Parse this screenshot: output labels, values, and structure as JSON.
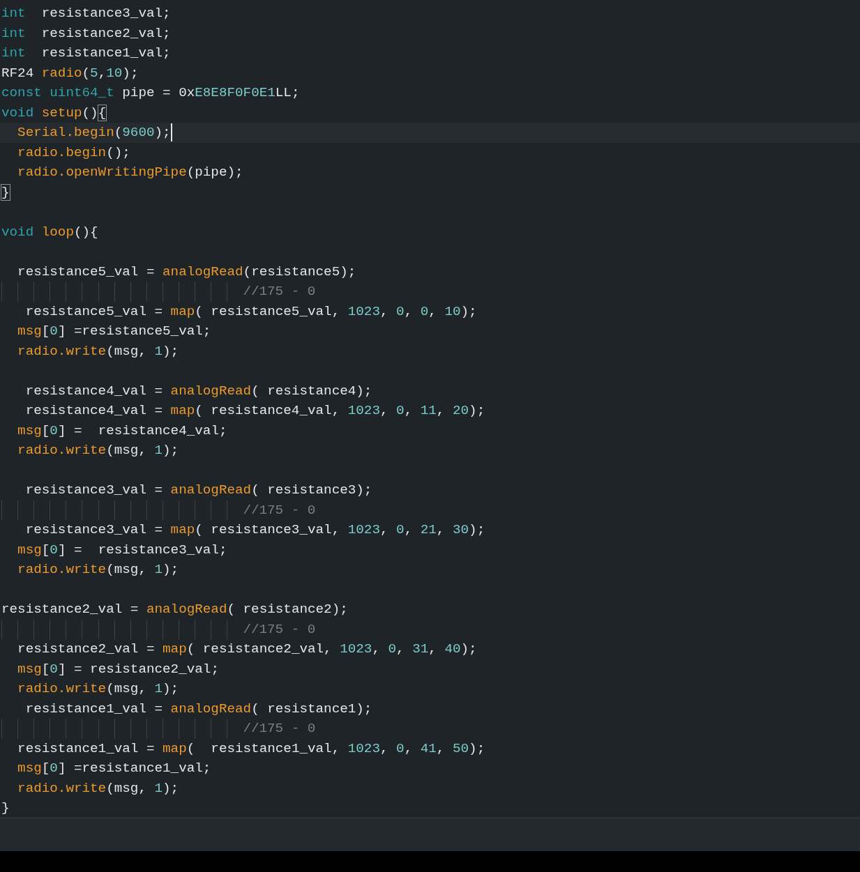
{
  "editor": {
    "lines": [
      {
        "kind": "code",
        "current": false,
        "tokens": [
          {
            "kind": "type",
            "text": "int"
          },
          {
            "kind": "plain",
            "text": "  resistance3_val;"
          }
        ]
      },
      {
        "kind": "code",
        "current": false,
        "tokens": [
          {
            "kind": "type",
            "text": "int"
          },
          {
            "kind": "plain",
            "text": "  resistance2_val;"
          }
        ]
      },
      {
        "kind": "code",
        "current": false,
        "tokens": [
          {
            "kind": "type",
            "text": "int"
          },
          {
            "kind": "plain",
            "text": "  resistance1_val;"
          }
        ]
      },
      {
        "kind": "code",
        "current": false,
        "tokens": [
          {
            "kind": "plain",
            "text": "RF24 "
          },
          {
            "kind": "func",
            "text": "radio"
          },
          {
            "kind": "plain",
            "text": "("
          },
          {
            "kind": "number",
            "text": "5"
          },
          {
            "kind": "plain",
            "text": ","
          },
          {
            "kind": "number",
            "text": "10"
          },
          {
            "kind": "plain",
            "text": ");"
          }
        ]
      },
      {
        "kind": "code",
        "current": false,
        "tokens": [
          {
            "kind": "type",
            "text": "const uint64_t"
          },
          {
            "kind": "plain",
            "text": " pipe = 0x"
          },
          {
            "kind": "number",
            "text": "E8E8F0F0E1"
          },
          {
            "kind": "plain",
            "text": "LL;"
          }
        ]
      },
      {
        "kind": "code",
        "current": false,
        "tokens": [
          {
            "kind": "type",
            "text": "void"
          },
          {
            "kind": "func",
            "text": " setup"
          },
          {
            "kind": "plain",
            "text": "()"
          },
          {
            "kind": "bracket",
            "text": "{"
          }
        ]
      },
      {
        "kind": "code",
        "current": true,
        "tokens": [
          {
            "kind": "func",
            "text": "  Serial.begin"
          },
          {
            "kind": "plain",
            "text": "("
          },
          {
            "kind": "number",
            "text": "9600"
          },
          {
            "kind": "plain",
            "text": ");"
          }
        ]
      },
      {
        "kind": "code",
        "current": false,
        "tokens": [
          {
            "kind": "func",
            "text": "  radio.begin"
          },
          {
            "kind": "plain",
            "text": "();"
          }
        ]
      },
      {
        "kind": "code",
        "current": false,
        "tokens": [
          {
            "kind": "func",
            "text": "  radio.openWritingPipe"
          },
          {
            "kind": "plain",
            "text": "(pipe);"
          }
        ]
      },
      {
        "kind": "code",
        "current": false,
        "tokens": [
          {
            "kind": "bracket",
            "text": "}"
          }
        ]
      },
      {
        "kind": "blank"
      },
      {
        "kind": "code",
        "current": false,
        "tokens": [
          {
            "kind": "type",
            "text": "void"
          },
          {
            "kind": "func",
            "text": " loop"
          },
          {
            "kind": "plain",
            "text": "(){"
          }
        ]
      },
      {
        "kind": "blank"
      },
      {
        "kind": "code",
        "current": false,
        "tokens": [
          {
            "kind": "plain",
            "text": "  resistance5_val = "
          },
          {
            "kind": "func",
            "text": "analogRead"
          },
          {
            "kind": "plain",
            "text": "(resistance5);"
          }
        ]
      },
      {
        "kind": "code",
        "current": false,
        "tokens": [
          {
            "kind": "guided-comment",
            "text": "//175 - 0"
          }
        ]
      },
      {
        "kind": "code",
        "current": false,
        "tokens": [
          {
            "kind": "plain",
            "text": "   resistance5_val = "
          },
          {
            "kind": "func",
            "text": "map"
          },
          {
            "kind": "plain",
            "text": "( resistance5_val, "
          },
          {
            "kind": "number",
            "text": "1023"
          },
          {
            "kind": "plain",
            "text": ", "
          },
          {
            "kind": "number",
            "text": "0"
          },
          {
            "kind": "plain",
            "text": ", "
          },
          {
            "kind": "number",
            "text": "0"
          },
          {
            "kind": "plain",
            "text": ", "
          },
          {
            "kind": "number",
            "text": "10"
          },
          {
            "kind": "plain",
            "text": ");"
          }
        ]
      },
      {
        "kind": "code",
        "current": false,
        "tokens": [
          {
            "kind": "func",
            "text": "  msg"
          },
          {
            "kind": "plain",
            "text": "["
          },
          {
            "kind": "number",
            "text": "0"
          },
          {
            "kind": "plain",
            "text": "] =resistance5_val;"
          }
        ]
      },
      {
        "kind": "code",
        "current": false,
        "tokens": [
          {
            "kind": "func",
            "text": "  radio.write"
          },
          {
            "kind": "plain",
            "text": "(msg, "
          },
          {
            "kind": "number",
            "text": "1"
          },
          {
            "kind": "plain",
            "text": ");"
          }
        ]
      },
      {
        "kind": "blank"
      },
      {
        "kind": "code",
        "current": false,
        "tokens": [
          {
            "kind": "plain",
            "text": "   resistance4_val = "
          },
          {
            "kind": "func",
            "text": "analogRead"
          },
          {
            "kind": "plain",
            "text": "( resistance4);"
          }
        ]
      },
      {
        "kind": "code",
        "current": false,
        "tokens": [
          {
            "kind": "plain",
            "text": "   resistance4_val = "
          },
          {
            "kind": "func",
            "text": "map"
          },
          {
            "kind": "plain",
            "text": "( resistance4_val, "
          },
          {
            "kind": "number",
            "text": "1023"
          },
          {
            "kind": "plain",
            "text": ", "
          },
          {
            "kind": "number",
            "text": "0"
          },
          {
            "kind": "plain",
            "text": ", "
          },
          {
            "kind": "number",
            "text": "11"
          },
          {
            "kind": "plain",
            "text": ", "
          },
          {
            "kind": "number",
            "text": "20"
          },
          {
            "kind": "plain",
            "text": ");"
          }
        ]
      },
      {
        "kind": "code",
        "current": false,
        "tokens": [
          {
            "kind": "func",
            "text": "  msg"
          },
          {
            "kind": "plain",
            "text": "["
          },
          {
            "kind": "number",
            "text": "0"
          },
          {
            "kind": "plain",
            "text": "] =  resistance4_val;"
          }
        ]
      },
      {
        "kind": "code",
        "current": false,
        "tokens": [
          {
            "kind": "func",
            "text": "  radio.write"
          },
          {
            "kind": "plain",
            "text": "(msg, "
          },
          {
            "kind": "number",
            "text": "1"
          },
          {
            "kind": "plain",
            "text": ");"
          }
        ]
      },
      {
        "kind": "blank"
      },
      {
        "kind": "code",
        "current": false,
        "tokens": [
          {
            "kind": "plain",
            "text": "   resistance3_val = "
          },
          {
            "kind": "func",
            "text": "analogRead"
          },
          {
            "kind": "plain",
            "text": "( resistance3);"
          }
        ]
      },
      {
        "kind": "code",
        "current": false,
        "tokens": [
          {
            "kind": "guided-comment",
            "text": "//175 - 0"
          }
        ]
      },
      {
        "kind": "code",
        "current": false,
        "tokens": [
          {
            "kind": "plain",
            "text": "   resistance3_val = "
          },
          {
            "kind": "func",
            "text": "map"
          },
          {
            "kind": "plain",
            "text": "( resistance3_val, "
          },
          {
            "kind": "number",
            "text": "1023"
          },
          {
            "kind": "plain",
            "text": ", "
          },
          {
            "kind": "number",
            "text": "0"
          },
          {
            "kind": "plain",
            "text": ", "
          },
          {
            "kind": "number",
            "text": "21"
          },
          {
            "kind": "plain",
            "text": ", "
          },
          {
            "kind": "number",
            "text": "30"
          },
          {
            "kind": "plain",
            "text": ");"
          }
        ]
      },
      {
        "kind": "code",
        "current": false,
        "tokens": [
          {
            "kind": "func",
            "text": "  msg"
          },
          {
            "kind": "plain",
            "text": "["
          },
          {
            "kind": "number",
            "text": "0"
          },
          {
            "kind": "plain",
            "text": "] =  resistance3_val;"
          }
        ]
      },
      {
        "kind": "code",
        "current": false,
        "tokens": [
          {
            "kind": "func",
            "text": "  radio.write"
          },
          {
            "kind": "plain",
            "text": "(msg, "
          },
          {
            "kind": "number",
            "text": "1"
          },
          {
            "kind": "plain",
            "text": ");"
          }
        ]
      },
      {
        "kind": "blank"
      },
      {
        "kind": "code",
        "current": false,
        "tokens": [
          {
            "kind": "plain",
            "text": "resistance2_val = "
          },
          {
            "kind": "func",
            "text": "analogRead"
          },
          {
            "kind": "plain",
            "text": "( resistance2);"
          }
        ]
      },
      {
        "kind": "code",
        "current": false,
        "tokens": [
          {
            "kind": "guided-comment",
            "text": "//175 - 0"
          }
        ]
      },
      {
        "kind": "code",
        "current": false,
        "tokens": [
          {
            "kind": "plain",
            "text": "  resistance2_val = "
          },
          {
            "kind": "func",
            "text": "map"
          },
          {
            "kind": "plain",
            "text": "( resistance2_val, "
          },
          {
            "kind": "number",
            "text": "1023"
          },
          {
            "kind": "plain",
            "text": ", "
          },
          {
            "kind": "number",
            "text": "0"
          },
          {
            "kind": "plain",
            "text": ", "
          },
          {
            "kind": "number",
            "text": "31"
          },
          {
            "kind": "plain",
            "text": ", "
          },
          {
            "kind": "number",
            "text": "40"
          },
          {
            "kind": "plain",
            "text": ");"
          }
        ]
      },
      {
        "kind": "code",
        "current": false,
        "tokens": [
          {
            "kind": "func",
            "text": "  msg"
          },
          {
            "kind": "plain",
            "text": "["
          },
          {
            "kind": "number",
            "text": "0"
          },
          {
            "kind": "plain",
            "text": "] = resistance2_val;"
          }
        ]
      },
      {
        "kind": "code",
        "current": false,
        "tokens": [
          {
            "kind": "func",
            "text": "  radio.write"
          },
          {
            "kind": "plain",
            "text": "(msg, "
          },
          {
            "kind": "number",
            "text": "1"
          },
          {
            "kind": "plain",
            "text": ");"
          }
        ]
      },
      {
        "kind": "code",
        "current": false,
        "tokens": [
          {
            "kind": "plain",
            "text": "   resistance1_val = "
          },
          {
            "kind": "func",
            "text": "analogRead"
          },
          {
            "kind": "plain",
            "text": "( resistance1);"
          }
        ]
      },
      {
        "kind": "code",
        "current": false,
        "tokens": [
          {
            "kind": "guided-comment",
            "text": "//175 - 0"
          }
        ]
      },
      {
        "kind": "code",
        "current": false,
        "tokens": [
          {
            "kind": "plain",
            "text": "  resistance1_val = "
          },
          {
            "kind": "func",
            "text": "map"
          },
          {
            "kind": "plain",
            "text": "(  resistance1_val, "
          },
          {
            "kind": "number",
            "text": "1023"
          },
          {
            "kind": "plain",
            "text": ", "
          },
          {
            "kind": "number",
            "text": "0"
          },
          {
            "kind": "plain",
            "text": ", "
          },
          {
            "kind": "number",
            "text": "41"
          },
          {
            "kind": "plain",
            "text": ", "
          },
          {
            "kind": "number",
            "text": "50"
          },
          {
            "kind": "plain",
            "text": ");"
          }
        ]
      },
      {
        "kind": "code",
        "current": false,
        "tokens": [
          {
            "kind": "func",
            "text": "  msg"
          },
          {
            "kind": "plain",
            "text": "["
          },
          {
            "kind": "number",
            "text": "0"
          },
          {
            "kind": "plain",
            "text": "] =resistance1_val;"
          }
        ]
      },
      {
        "kind": "code",
        "current": false,
        "tokens": [
          {
            "kind": "func",
            "text": "  radio.write"
          },
          {
            "kind": "plain",
            "text": "(msg, "
          },
          {
            "kind": "number",
            "text": "1"
          },
          {
            "kind": "plain",
            "text": ");"
          }
        ]
      },
      {
        "kind": "code",
        "current": false,
        "tokens": [
          {
            "kind": "plain",
            "text": "}"
          }
        ]
      }
    ]
  }
}
